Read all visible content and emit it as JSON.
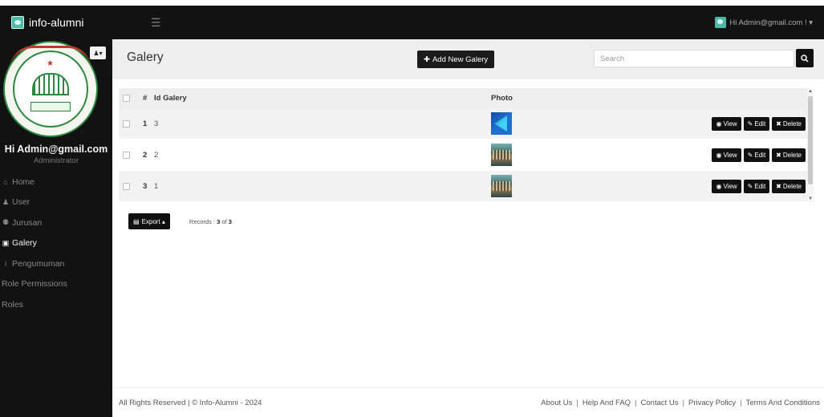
{
  "app": {
    "brand": "info-alumni",
    "user_greeting": "Hi Admin@gmail.com ! ▾"
  },
  "sidebar": {
    "user_name": "Hi Admin@gmail.com",
    "user_role": "Administrator",
    "items": [
      {
        "icon": "home-icon",
        "glyph": "⌂",
        "label": "Home"
      },
      {
        "icon": "user-icon",
        "glyph": "♟",
        "label": "User"
      },
      {
        "icon": "users-icon",
        "glyph": "⚉",
        "label": "Jurusan"
      },
      {
        "icon": "image-icon",
        "glyph": "▣",
        "label": "Galery"
      },
      {
        "icon": "info-icon",
        "glyph": "i",
        "label": "Pengumuman"
      },
      {
        "icon": "",
        "glyph": "",
        "label": "Role Permissions"
      },
      {
        "icon": "",
        "glyph": "",
        "label": "Roles"
      }
    ],
    "active_index": 3
  },
  "header": {
    "title": "Galery",
    "add_button": "Add New Galery",
    "search_placeholder": "Search"
  },
  "table": {
    "columns": {
      "num": "#",
      "id": "Id Galery",
      "photo": "Photo"
    },
    "rows": [
      {
        "num": "1",
        "id": "3",
        "photo": "blue-logo"
      },
      {
        "num": "2",
        "id": "2",
        "photo": "building"
      },
      {
        "num": "3",
        "id": "1",
        "photo": "building"
      }
    ],
    "actions": {
      "view": "View",
      "edit": "Edit",
      "delete": "Delete"
    }
  },
  "export": {
    "label": "Export ▴",
    "records_prefix": "Records : ",
    "records_shown": "3",
    "records_of": " of ",
    "records_total": "3"
  },
  "footer": {
    "copyright": "All Rights Reserved | © Info-Alumni - 2024",
    "links": [
      "About Us",
      "Help And FAQ",
      "Contact Us",
      "Privacy Policy",
      "Terms And Conditions"
    ]
  },
  "colors": {
    "dark": "#121212",
    "accent": "#4fb8a6",
    "headbar": "#eeeeee"
  }
}
